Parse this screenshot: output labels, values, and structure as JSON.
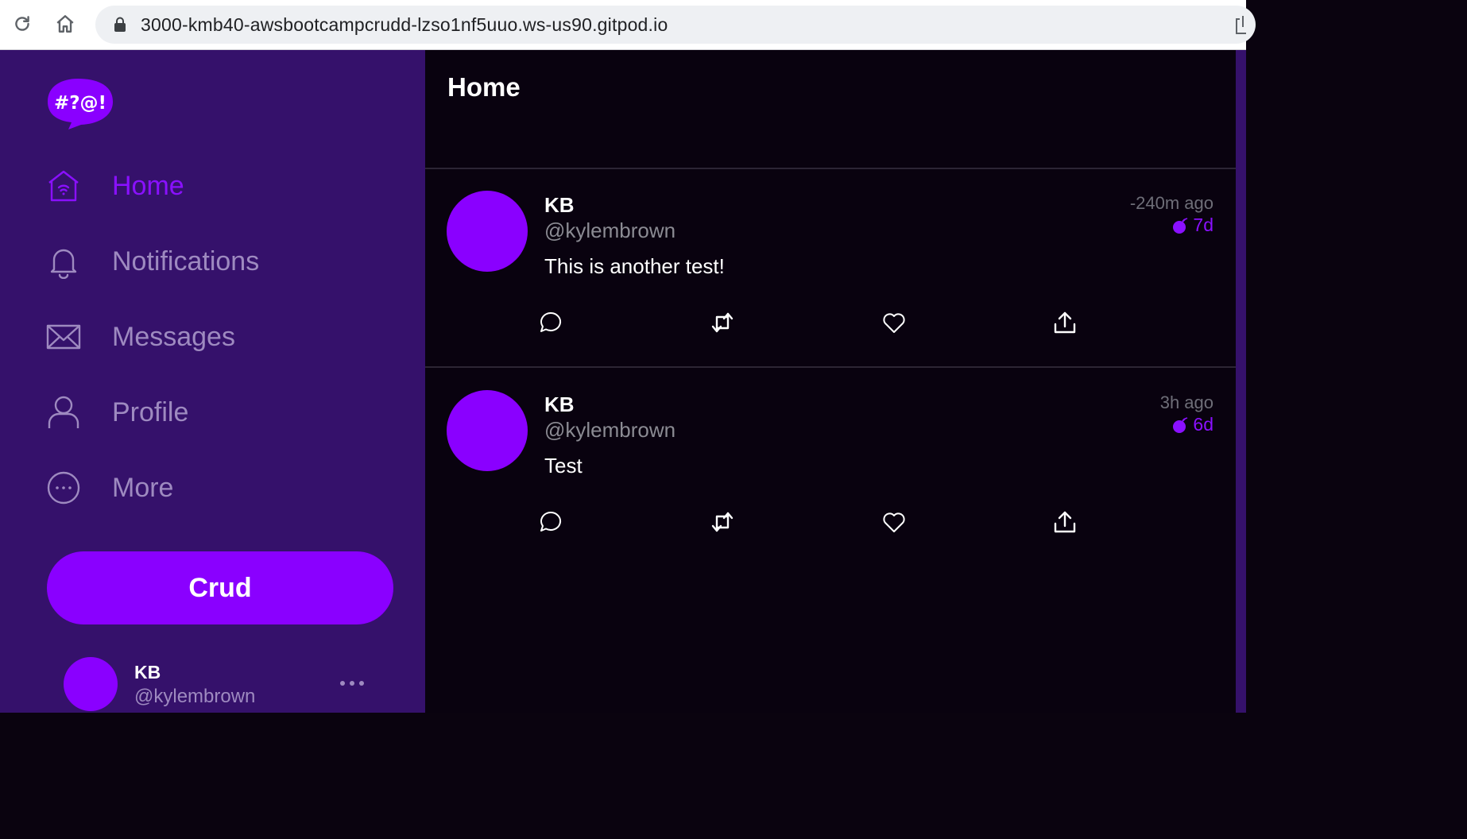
{
  "browser": {
    "url": "3000-kmb40-awsbootcampcrudd-lzso1nf5uuo.ws-us90.gitpod.io"
  },
  "brand": {
    "logo_text": "#?@!",
    "accent_color": "#8a00ff",
    "sidebar_color": "#35116b"
  },
  "sidebar": {
    "items": [
      {
        "label": "Home",
        "icon": "home-icon",
        "active": true
      },
      {
        "label": "Notifications",
        "icon": "bell-icon",
        "active": false
      },
      {
        "label": "Messages",
        "icon": "envelope-icon",
        "active": false
      },
      {
        "label": "Profile",
        "icon": "person-icon",
        "active": false
      },
      {
        "label": "More",
        "icon": "more-circle-icon",
        "active": false
      }
    ],
    "crud_button_label": "Crud",
    "profile": {
      "name": "KB",
      "handle": "@kylembrown"
    }
  },
  "main": {
    "title": "Home",
    "posts": [
      {
        "name": "KB",
        "handle": "@kylembrown",
        "text": "This is another test!",
        "time": "-240m ago",
        "expires": "7d"
      },
      {
        "name": "KB",
        "handle": "@kylembrown",
        "text": "Test",
        "time": "3h ago",
        "expires": "6d"
      }
    ]
  }
}
